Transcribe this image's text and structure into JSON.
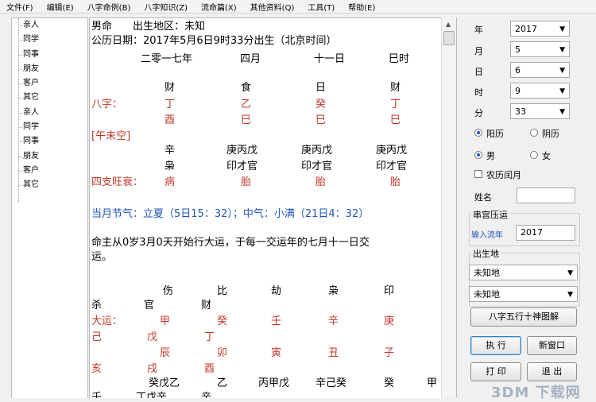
{
  "menu": [
    "文件(F)",
    "编辑(E)",
    "八字命例(B)",
    "八字知识(Z)",
    "流命篇(X)",
    "其他资料(Q)",
    "工具(T)",
    "帮助(E)"
  ],
  "left_list": [
    "亲人",
    "同学",
    "同事",
    "朋友",
    "客户",
    "其它",
    "亲人",
    "同学",
    "同事",
    "朋友",
    "客户",
    "其它"
  ],
  "main": {
    "line1": "男命　　出生地区：未知",
    "line2": "公历日期：2017年5月6日9时33分出生（北京时间）",
    "lunar": [
      "二零一七年",
      "四月",
      "十一日",
      "巳时"
    ],
    "gods": [
      "财",
      "食",
      "日",
      "财"
    ],
    "bazi_label": "八字：",
    "stems": [
      "丁",
      "乙",
      "癸",
      "丁"
    ],
    "branches": [
      "酉",
      "巳",
      "巳",
      "巳"
    ],
    "void": "[午未空]",
    "hidden": [
      "辛",
      "庚丙戊",
      "庚丙戊",
      "庚丙戊"
    ],
    "hidden_gods": [
      "枭",
      "印才官",
      "印才官",
      "印才官"
    ],
    "state_label": "四支旺衰：",
    "states": [
      "病",
      "胎",
      "胎",
      "胎"
    ],
    "solar_term": "当月节气：立夏（5日15：32）；中气：小满（21日4：32）",
    "luck_line1": "命主从0岁3月0天开始行大运，于每一交运年的七月十一日交",
    "luck_line2": "运。",
    "dy_gods_row1": [
      "伤",
      "比",
      "劫",
      "枭",
      "印"
    ],
    "dy_gods_row2": [
      "杀",
      "官",
      "财"
    ],
    "dayun_label": "大运：",
    "dy_stems1": [
      "甲",
      "癸",
      "壬",
      "辛",
      "庚"
    ],
    "dy_stems2": [
      "己",
      "戊",
      "丁"
    ],
    "dy_branches1": [
      "辰",
      "卯",
      "寅",
      "丑",
      "子"
    ],
    "dy_branches2": [
      "亥",
      "戌",
      "酉"
    ],
    "dy_hidden": [
      "癸戊乙",
      "乙",
      "丙甲戊",
      "辛己癸",
      "癸",
      "甲"
    ],
    "last_row": [
      "壬",
      "丁戊辛",
      "辛"
    ]
  },
  "right": {
    "year_label": "年",
    "year": "2017",
    "month_label": "月",
    "month": "5",
    "day_label": "日",
    "day": "6",
    "hour_label": "时",
    "hour": "9",
    "minute_label": "分",
    "minute": "33",
    "solar": "阳历",
    "lunar": "阴历",
    "male": "男",
    "female": "女",
    "leap": "农历闰月",
    "name_label": "姓名",
    "liuyun_group": "串宫压运",
    "input_year_label": "输入流年",
    "input_year": "2017",
    "birthplace_group": "出生地",
    "place1": "未知地",
    "place2": "未知地",
    "btn_chart": "八字五行十神图解",
    "btn_run": "执 行",
    "btn_new": "新窗口",
    "btn_print": "打 印",
    "btn_exit": "退 出"
  },
  "watermark": "3DM 下载网"
}
